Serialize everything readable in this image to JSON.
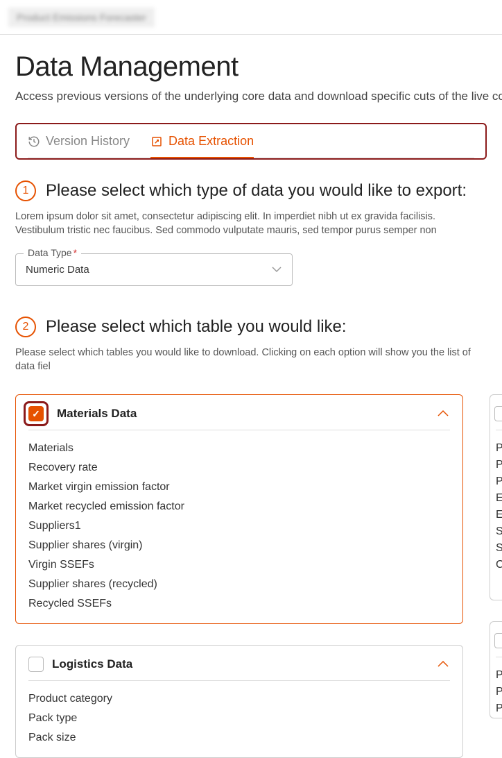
{
  "app": {
    "title": "Product Emissions Forecaster"
  },
  "page": {
    "title": "Data Management",
    "subtitle": "Access previous versions of the underlying core data and download specific cuts of the live core d"
  },
  "tabs": {
    "version_history": "Version History",
    "data_extraction": "Data Extraction"
  },
  "step1": {
    "number": "1",
    "title": "Please select which type of data you would like to export:",
    "desc": "Lorem ipsum dolor sit amet, consectetur adipiscing elit. In imperdiet nibh ut ex gravida facilisis. Vestibulum tristic nec faucibus. Sed commodo vulputate mauris, sed tempor purus semper non",
    "field_label": "Data Type",
    "field_value": "Numeric Data"
  },
  "step2": {
    "number": "2",
    "title": "Please select which table you would like:",
    "desc": "Please select which tables you would like to download. Clicking on each option will show you the list of data fiel"
  },
  "cards": {
    "materials": {
      "title": "Materials Data",
      "items": [
        "Materials",
        "Recovery rate",
        "Market virgin emission factor",
        "Market recycled emission factor",
        "Suppliers1",
        "Supplier shares (virgin)",
        "Virgin SSEFs",
        "Supplier shares (recycled)",
        "Recycled SSEFs"
      ]
    },
    "logistics": {
      "title": "Logistics Data",
      "items": [
        "Product category",
        "Pack type",
        "Pack size"
      ]
    },
    "side1": {
      "items": [
        "P",
        "P",
        "P",
        "E",
        "E",
        "S",
        "S",
        "C"
      ]
    },
    "side2": {
      "items": [
        "P",
        "P",
        "P"
      ]
    }
  }
}
